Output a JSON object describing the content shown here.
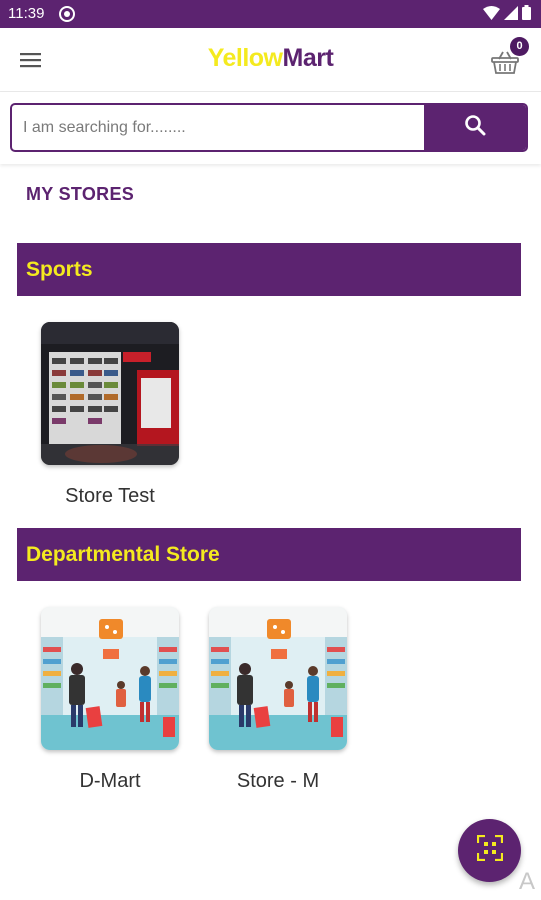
{
  "status_bar": {
    "time": "11:39"
  },
  "app_bar": {
    "brand_part1": "Yellow",
    "brand_part2": "Mart",
    "cart_count": "0"
  },
  "search": {
    "placeholder": "I am searching for........"
  },
  "section": {
    "title": "MY STORES"
  },
  "categories": [
    {
      "name": "Sports",
      "stores": [
        {
          "name": "Store Test"
        }
      ]
    },
    {
      "name": "Departmental Store",
      "stores": [
        {
          "name": "D-Mart"
        },
        {
          "name": "Store - M"
        }
      ]
    }
  ],
  "corner_text": "A",
  "colors": {
    "primary": "#5c2370",
    "accent": "#f4ea1f"
  }
}
